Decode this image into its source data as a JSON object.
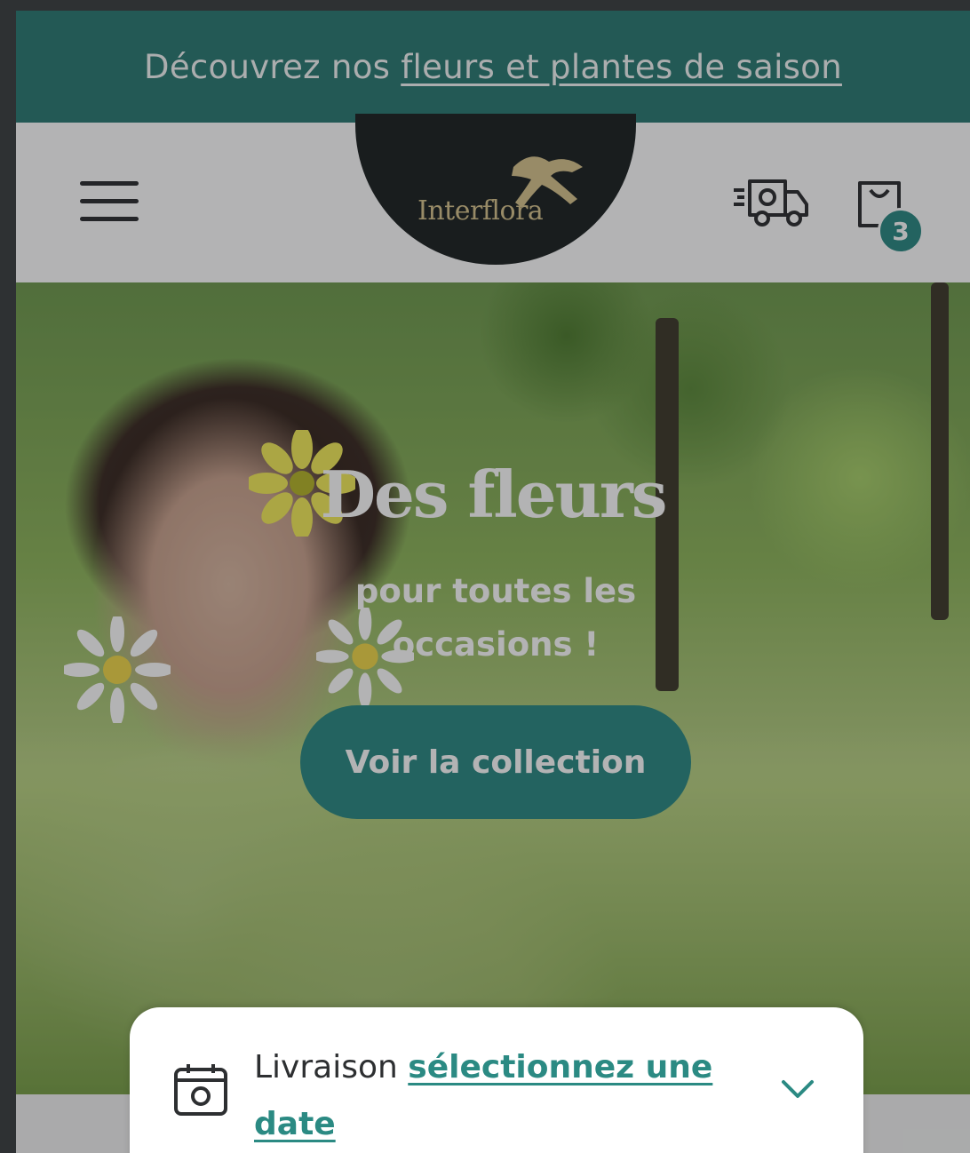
{
  "promo": {
    "prefix": "Découvrez nos",
    "link": "fleurs et plantes de saison"
  },
  "header": {
    "logo": "Interflora",
    "cart_count": "3"
  },
  "hero": {
    "title": "Des fleurs",
    "subtitle": "pour toutes les occasions !",
    "cta": "Voir la collection"
  },
  "delivery": {
    "label": "Livraison",
    "link": "sélectionnez une date"
  },
  "colors": {
    "teal": "#2b8a83",
    "banner": "#2b7b74",
    "logo_bg": "#1c2222",
    "logo_gold": "#d8c48e"
  }
}
